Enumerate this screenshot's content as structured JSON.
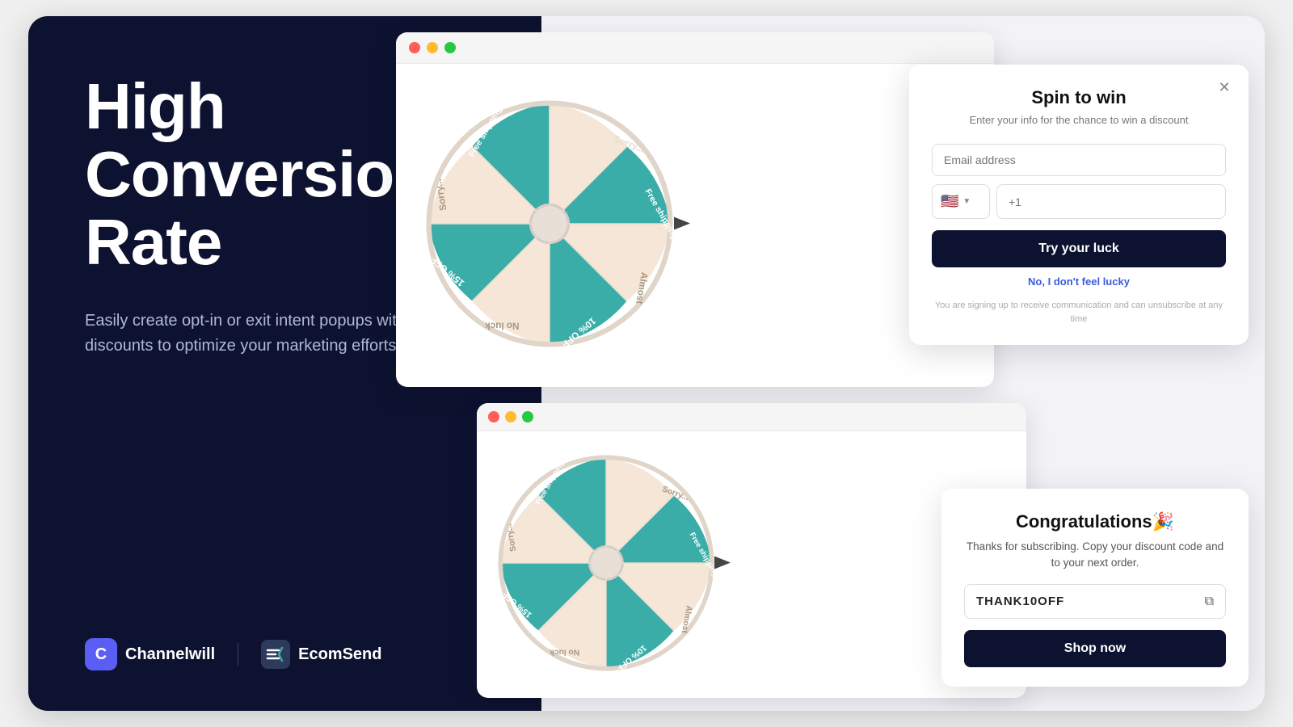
{
  "left": {
    "title_line1": "High",
    "title_line2": "Conversion",
    "title_line3": "Rate",
    "subtitle": "Easily create opt-in or exit intent popups with discounts to optimize your marketing efforts.",
    "brand1_letter": "C",
    "brand1_name": "Channelwill",
    "brand2_name": "EcomSend"
  },
  "spin_popup": {
    "close_label": "✕",
    "title": "Spin to win",
    "subtitle": "Enter your info for the chance to win a discount",
    "email_placeholder": "Email address",
    "phone_placeholder": "+1",
    "flag_emoji": "🇺🇸",
    "try_luck_label": "Try your luck",
    "no_lucky_label": "No, I don't feel lucky",
    "disclaimer": "You are signing up to receive communication and can unsubscribe at any time"
  },
  "congrats_popup": {
    "title": "Congratulations🎉",
    "text": "Thanks for subscribing. Copy your discount code and to your next order.",
    "code": "THANK10OFF",
    "copy_icon": "⧉",
    "shop_now_label": "Shop now"
  },
  "wheel": {
    "segments": [
      {
        "label": "Sorry...",
        "color": "#f5e6d8",
        "angle": 0
      },
      {
        "label": "Free shipping",
        "color": "#3aada8",
        "angle": 40
      },
      {
        "label": "Almost",
        "color": "#f5e6d8",
        "angle": 80
      },
      {
        "label": "10% OFF",
        "color": "#3aada8",
        "angle": 120
      },
      {
        "label": "No luck",
        "color": "#f5e6d8",
        "angle": 160
      },
      {
        "label": "15% OFF",
        "color": "#3aada8",
        "angle": 200
      },
      {
        "label": "Sorry...",
        "color": "#f5e6d8",
        "angle": 240
      },
      {
        "label": "Free shipping",
        "color": "#3aada8",
        "angle": 280
      },
      {
        "label": "Almost",
        "color": "#f5e6d8",
        "angle": 320
      }
    ]
  },
  "colors": {
    "teal": "#3aada8",
    "cream": "#f5e6d8",
    "dark_navy": "#0d1230",
    "brand_purple": "#5b5ef4"
  }
}
